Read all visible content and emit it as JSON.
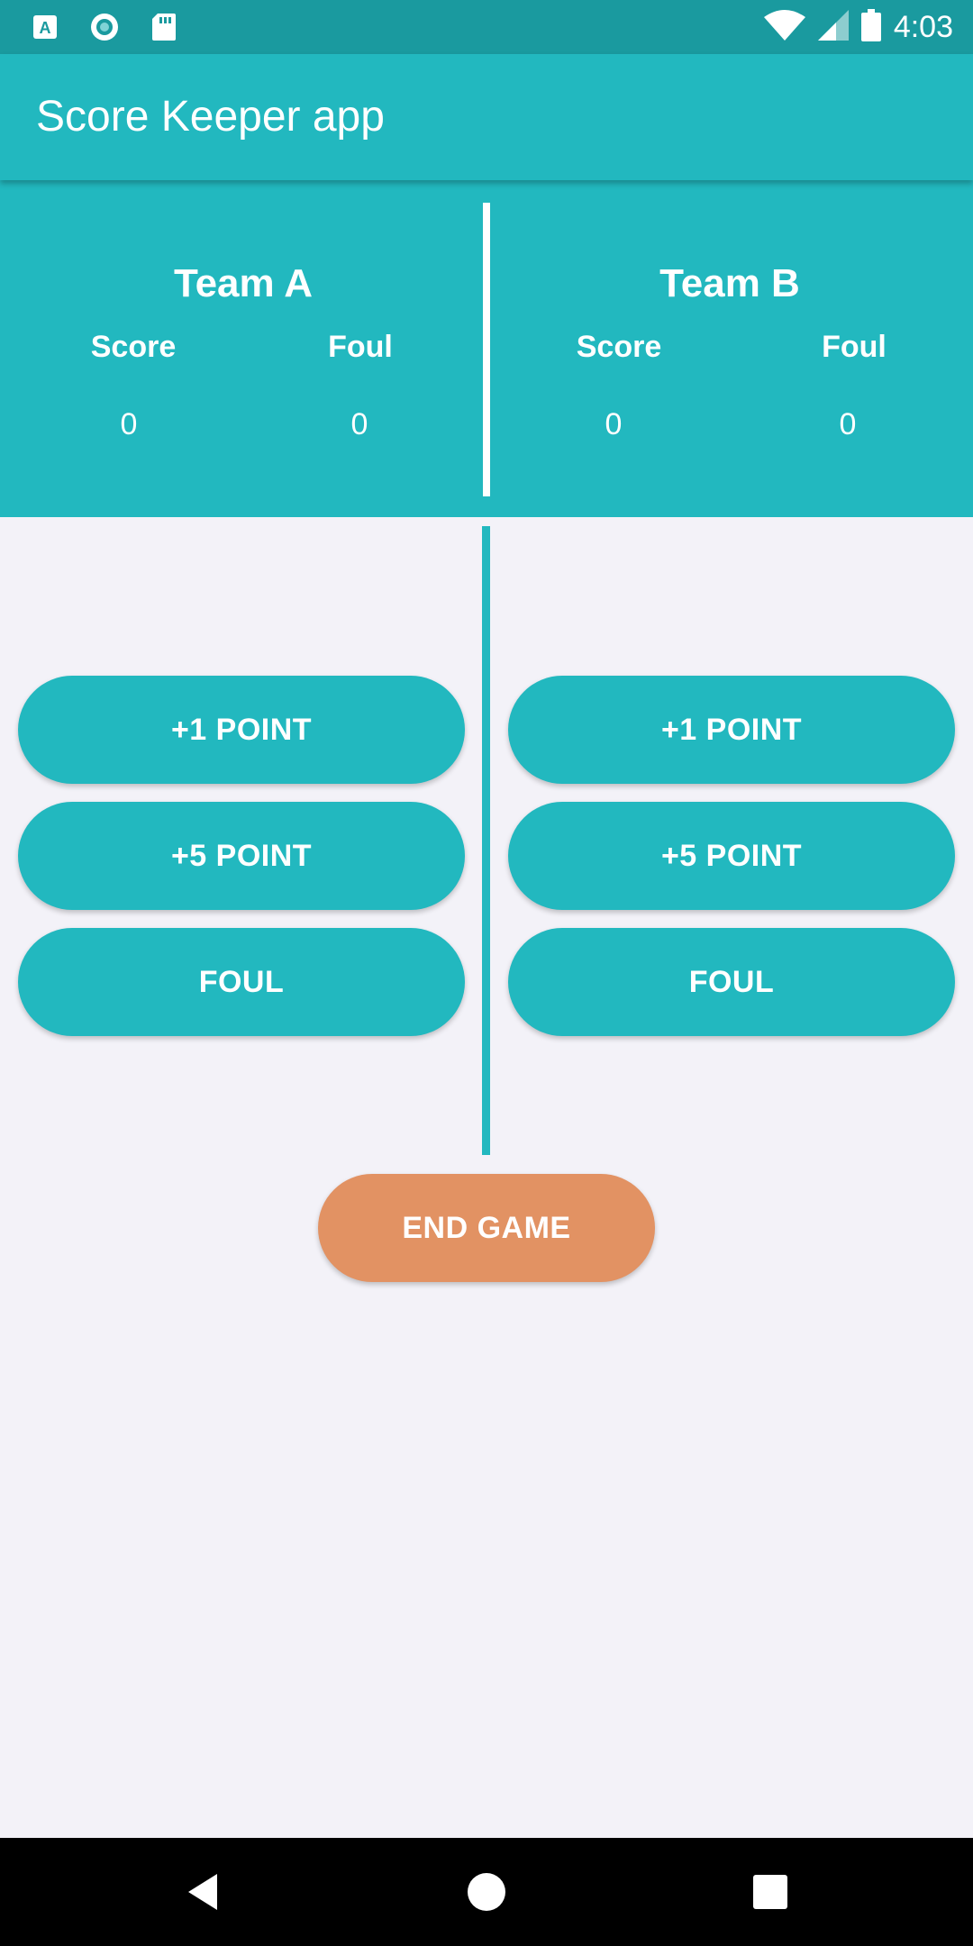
{
  "status_bar": {
    "time": "4:03",
    "left_icons": [
      "font-a-icon",
      "sync-circle-icon",
      "sd-card-icon"
    ],
    "right_icons": [
      "wifi-icon",
      "cell-signal-icon",
      "battery-icon"
    ]
  },
  "app_bar": {
    "title": "Score Keeper app"
  },
  "teams": [
    {
      "name": "Team A",
      "score_label": "Score",
      "foul_label": "Foul",
      "score": "0",
      "foul": "0"
    },
    {
      "name": "Team B",
      "score_label": "Score",
      "foul_label": "Foul",
      "score": "0",
      "foul": "0"
    }
  ],
  "buttons": {
    "team_a": {
      "plus_one": "+1 POINT",
      "plus_five": "+5 POINT",
      "foul": "FOUL"
    },
    "team_b": {
      "plus_one": "+1 POINT",
      "plus_five": "+5 POINT",
      "foul": "FOUL"
    },
    "end_game": "END GAME"
  },
  "nav_bar": {
    "icons": [
      "back-icon",
      "home-icon",
      "recents-icon"
    ]
  },
  "colors": {
    "primary": "#22b8bf",
    "primary_dark": "#1a9a9f",
    "accent": "#e29263",
    "background": "#f3f2f8"
  }
}
